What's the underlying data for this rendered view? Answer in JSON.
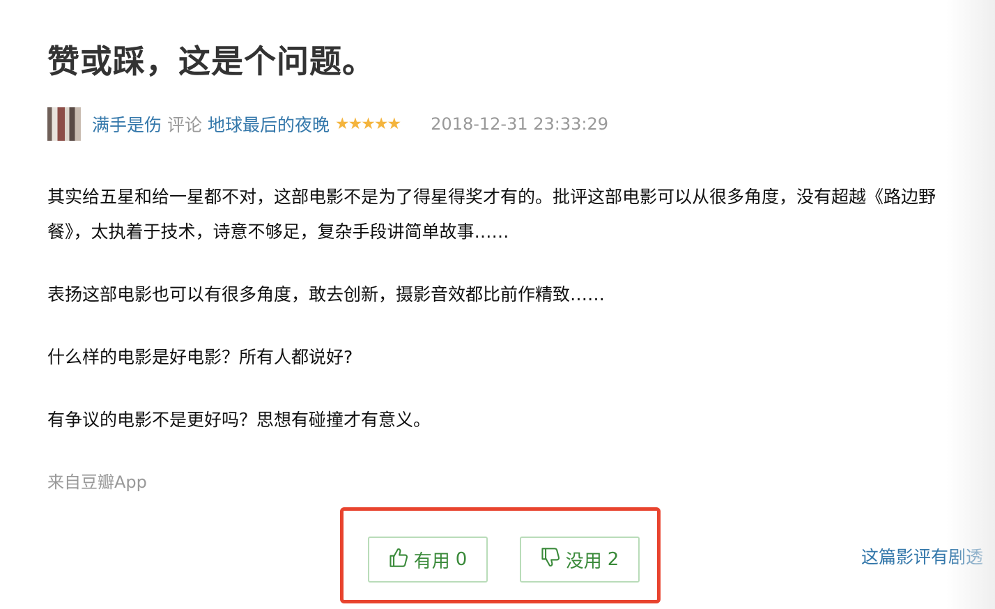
{
  "review": {
    "title": "赞或踩，这是个问题。",
    "author": "满手是伤",
    "action": "评论",
    "movie": "地球最后的夜晚",
    "rating_stars": 5,
    "stars_display": "★★★★★",
    "timestamp": "2018-12-31 23:33:29",
    "paragraphs": [
      "其实给五星和给一星都不对，这部电影不是为了得星得奖才有的。批评这部电影可以从很多角度，没有超越《路边野餐》，太执着于技术，诗意不够足，复杂手段讲简单故事……",
      "表扬这部电影也可以有很多角度，敢去创新，摄影音效都比前作精致……",
      "什么样的电影是好电影？所有人都说好?",
      "有争议的电影不是更好吗？思想有碰撞才有意义。"
    ],
    "source": "来自豆瓣App"
  },
  "votes": {
    "useful_label": "有用",
    "useful_count": "0",
    "useless_label": "没用",
    "useless_count": "2"
  },
  "spoiler_link": "这篇影评有剧透",
  "colors": {
    "link": "#3377aa",
    "star": "#f4b43d",
    "vote_text": "#3a8a3a",
    "vote_border": "#b9dcb9",
    "highlight_box": "#e8432e",
    "muted": "#999999"
  },
  "icons": {
    "useful": "thumbs-up-icon",
    "useless": "thumbs-down-icon"
  }
}
